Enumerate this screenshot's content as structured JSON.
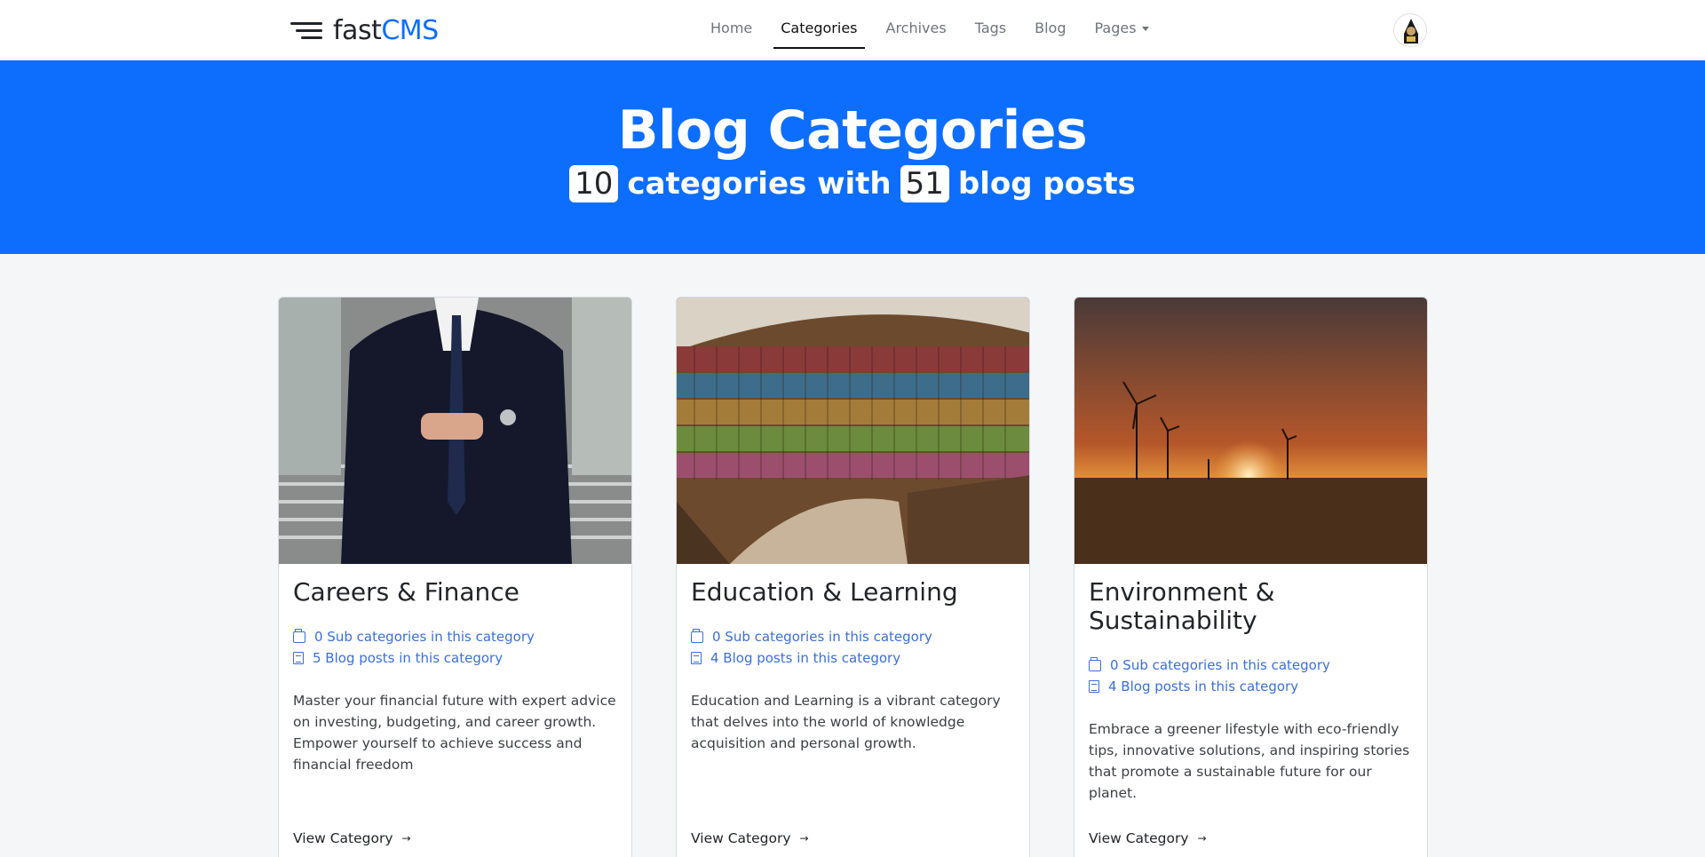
{
  "brand": {
    "part1": "fast",
    "part2": "CMS"
  },
  "nav": [
    {
      "label": "Home"
    },
    {
      "label": "Categories"
    },
    {
      "label": "Archives"
    },
    {
      "label": "Tags"
    },
    {
      "label": "Blog"
    },
    {
      "label": "Pages"
    }
  ],
  "hero": {
    "title": "Blog Categories",
    "category_count": "10",
    "text_mid": "categories with",
    "post_count": "51",
    "text_end": "blog posts"
  },
  "cards": [
    {
      "title": "Careers & Finance",
      "subcats": "0 Sub categories in this category",
      "posts": "5 Blog posts in this category",
      "desc": "Master your financial future with expert advice on investing, budgeting, and career growth. Empower yourself to achieve success and financial freedom",
      "cta": "View Category"
    },
    {
      "title": "Education & Learning",
      "subcats": "0 Sub categories in this category",
      "posts": "4 Blog posts in this category",
      "desc": "Education and Learning is a vibrant category that delves into the world of knowledge acquisition and personal growth.",
      "cta": "View Category"
    },
    {
      "title": "Environment & Sustainability",
      "subcats": "0 Sub categories in this category",
      "posts": "4 Blog posts in this category",
      "desc": "Embrace a greener lifestyle with eco-friendly tips, innovative solutions, and inspiring stories that promote a sustainable future for our planet.",
      "cta": "View Category"
    }
  ],
  "colors": {
    "primary": "#0d6efd",
    "link": "#3a6fd8"
  }
}
